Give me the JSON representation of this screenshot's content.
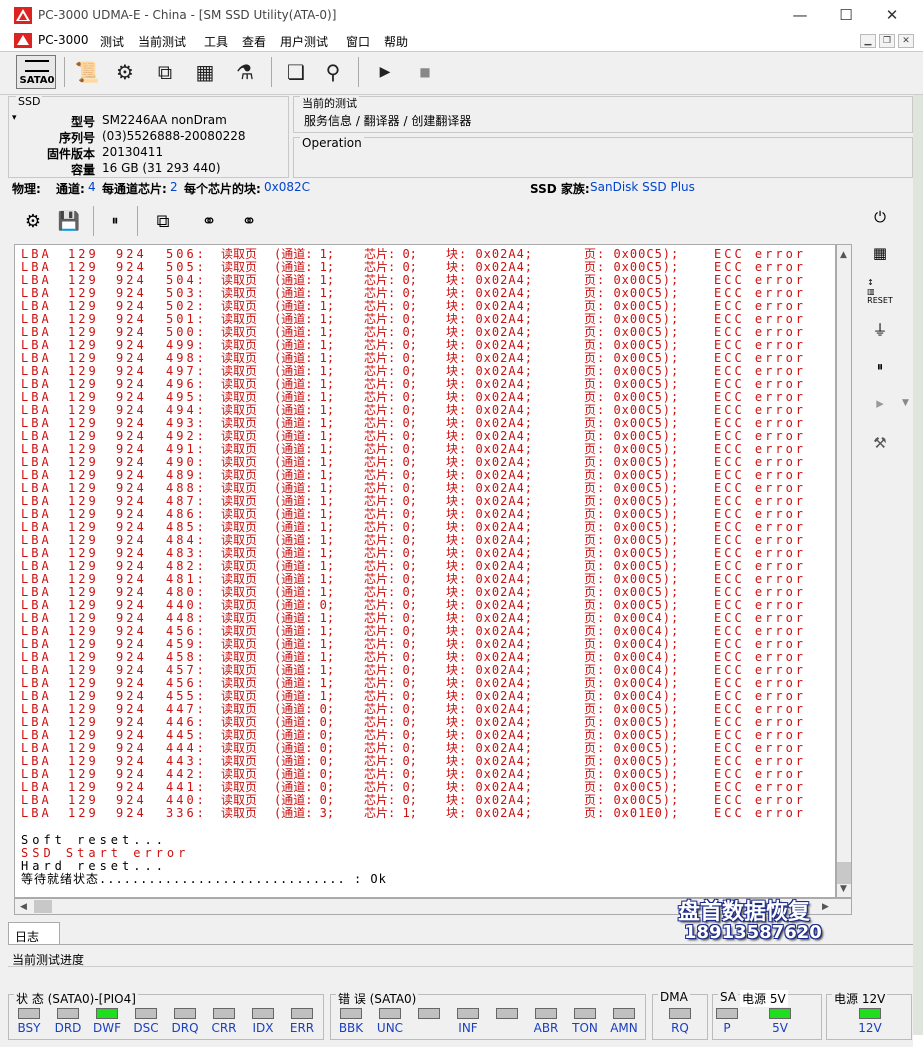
{
  "window": {
    "title": "PC-3000 UDMA-E - China - [SM SSD Utility(ATA-0)]",
    "min": "—",
    "max": "☐",
    "close": "✕"
  },
  "menu": [
    "PC-3000",
    "测试",
    "当前测试",
    "工具",
    "查看",
    "用户测试",
    "窗口",
    "帮助"
  ],
  "toolbar": {
    "sata_label": "SATA0"
  },
  "ssd": {
    "group_title": "SSD",
    "fields": [
      {
        "label": "型号",
        "value": "SM2246AA nonDram"
      },
      {
        "label": "序列号",
        "value": "(03)5526888-20080228"
      },
      {
        "label": "固件版本",
        "value": "20130411"
      },
      {
        "label": "容量",
        "value": "16 GB (31 293 440)"
      }
    ]
  },
  "current_test": {
    "title": "当前的测试",
    "path": "服务信息 / 翻译器 / 创建翻译器"
  },
  "operation": {
    "title": "Operation"
  },
  "physical": {
    "label": "物理:",
    "channels_label": "通道:",
    "channels": "4",
    "chips_label": "每通道芯片:",
    "chips": "2",
    "blocks_label": "每个芯片的块:",
    "blocks": "0x082C",
    "family_label": "SSD 家族:",
    "family": "SanDisk SSD Plus"
  },
  "log": {
    "rows": [
      {
        "lba": "LBA",
        "n1": "129",
        "n2": "924",
        "n3": "506:",
        "op": "读取页",
        "ch": "(通道: 1;",
        "chip": "芯片: 0;",
        "blk": "块: 0x02A4;",
        "pg": "页: 0x00C5);",
        "err": "ECC error"
      },
      {
        "lba": "LBA",
        "n1": "129",
        "n2": "924",
        "n3": "505:",
        "op": "读取页",
        "ch": "(通道: 1;",
        "chip": "芯片: 0;",
        "blk": "块: 0x02A4;",
        "pg": "页: 0x00C5);",
        "err": "ECC error"
      },
      {
        "lba": "LBA",
        "n1": "129",
        "n2": "924",
        "n3": "504:",
        "op": "读取页",
        "ch": "(通道: 1;",
        "chip": "芯片: 0;",
        "blk": "块: 0x02A4;",
        "pg": "页: 0x00C5);",
        "err": "ECC error"
      },
      {
        "lba": "LBA",
        "n1": "129",
        "n2": "924",
        "n3": "503:",
        "op": "读取页",
        "ch": "(通道: 1;",
        "chip": "芯片: 0;",
        "blk": "块: 0x02A4;",
        "pg": "页: 0x00C5);",
        "err": "ECC error"
      },
      {
        "lba": "LBA",
        "n1": "129",
        "n2": "924",
        "n3": "502:",
        "op": "读取页",
        "ch": "(通道: 1;",
        "chip": "芯片: 0;",
        "blk": "块: 0x02A4;",
        "pg": "页: 0x00C5);",
        "err": "ECC error"
      },
      {
        "lba": "LBA",
        "n1": "129",
        "n2": "924",
        "n3": "501:",
        "op": "读取页",
        "ch": "(通道: 1;",
        "chip": "芯片: 0;",
        "blk": "块: 0x02A4;",
        "pg": "页: 0x00C5);",
        "err": "ECC error"
      },
      {
        "lba": "LBA",
        "n1": "129",
        "n2": "924",
        "n3": "500:",
        "op": "读取页",
        "ch": "(通道: 1;",
        "chip": "芯片: 0;",
        "blk": "块: 0x02A4;",
        "pg": "页: 0x00C5);",
        "err": "ECC error"
      },
      {
        "lba": "LBA",
        "n1": "129",
        "n2": "924",
        "n3": "499:",
        "op": "读取页",
        "ch": "(通道: 1;",
        "chip": "芯片: 0;",
        "blk": "块: 0x02A4;",
        "pg": "页: 0x00C5);",
        "err": "ECC error"
      },
      {
        "lba": "LBA",
        "n1": "129",
        "n2": "924",
        "n3": "498:",
        "op": "读取页",
        "ch": "(通道: 1;",
        "chip": "芯片: 0;",
        "blk": "块: 0x02A4;",
        "pg": "页: 0x00C5);",
        "err": "ECC error"
      },
      {
        "lba": "LBA",
        "n1": "129",
        "n2": "924",
        "n3": "497:",
        "op": "读取页",
        "ch": "(通道: 1;",
        "chip": "芯片: 0;",
        "blk": "块: 0x02A4;",
        "pg": "页: 0x00C5);",
        "err": "ECC error"
      },
      {
        "lba": "LBA",
        "n1": "129",
        "n2": "924",
        "n3": "496:",
        "op": "读取页",
        "ch": "(通道: 1;",
        "chip": "芯片: 0;",
        "blk": "块: 0x02A4;",
        "pg": "页: 0x00C5);",
        "err": "ECC error"
      },
      {
        "lba": "LBA",
        "n1": "129",
        "n2": "924",
        "n3": "495:",
        "op": "读取页",
        "ch": "(通道: 1;",
        "chip": "芯片: 0;",
        "blk": "块: 0x02A4;",
        "pg": "页: 0x00C5);",
        "err": "ECC error"
      },
      {
        "lba": "LBA",
        "n1": "129",
        "n2": "924",
        "n3": "494:",
        "op": "读取页",
        "ch": "(通道: 1;",
        "chip": "芯片: 0;",
        "blk": "块: 0x02A4;",
        "pg": "页: 0x00C5);",
        "err": "ECC error"
      },
      {
        "lba": "LBA",
        "n1": "129",
        "n2": "924",
        "n3": "493:",
        "op": "读取页",
        "ch": "(通道: 1;",
        "chip": "芯片: 0;",
        "blk": "块: 0x02A4;",
        "pg": "页: 0x00C5);",
        "err": "ECC error"
      },
      {
        "lba": "LBA",
        "n1": "129",
        "n2": "924",
        "n3": "492:",
        "op": "读取页",
        "ch": "(通道: 1;",
        "chip": "芯片: 0;",
        "blk": "块: 0x02A4;",
        "pg": "页: 0x00C5);",
        "err": "ECC error"
      },
      {
        "lba": "LBA",
        "n1": "129",
        "n2": "924",
        "n3": "491:",
        "op": "读取页",
        "ch": "(通道: 1;",
        "chip": "芯片: 0;",
        "blk": "块: 0x02A4;",
        "pg": "页: 0x00C5);",
        "err": "ECC error"
      },
      {
        "lba": "LBA",
        "n1": "129",
        "n2": "924",
        "n3": "490:",
        "op": "读取页",
        "ch": "(通道: 1;",
        "chip": "芯片: 0;",
        "blk": "块: 0x02A4;",
        "pg": "页: 0x00C5);",
        "err": "ECC error"
      },
      {
        "lba": "LBA",
        "n1": "129",
        "n2": "924",
        "n3": "489:",
        "op": "读取页",
        "ch": "(通道: 1;",
        "chip": "芯片: 0;",
        "blk": "块: 0x02A4;",
        "pg": "页: 0x00C5);",
        "err": "ECC error"
      },
      {
        "lba": "LBA",
        "n1": "129",
        "n2": "924",
        "n3": "488:",
        "op": "读取页",
        "ch": "(通道: 1;",
        "chip": "芯片: 0;",
        "blk": "块: 0x02A4;",
        "pg": "页: 0x00C5);",
        "err": "ECC error"
      },
      {
        "lba": "LBA",
        "n1": "129",
        "n2": "924",
        "n3": "487:",
        "op": "读取页",
        "ch": "(通道: 1;",
        "chip": "芯片: 0;",
        "blk": "块: 0x02A4;",
        "pg": "页: 0x00C5);",
        "err": "ECC error"
      },
      {
        "lba": "LBA",
        "n1": "129",
        "n2": "924",
        "n3": "486:",
        "op": "读取页",
        "ch": "(通道: 1;",
        "chip": "芯片: 0;",
        "blk": "块: 0x02A4;",
        "pg": "页: 0x00C5);",
        "err": "ECC error"
      },
      {
        "lba": "LBA",
        "n1": "129",
        "n2": "924",
        "n3": "485:",
        "op": "读取页",
        "ch": "(通道: 1;",
        "chip": "芯片: 0;",
        "blk": "块: 0x02A4;",
        "pg": "页: 0x00C5);",
        "err": "ECC error"
      },
      {
        "lba": "LBA",
        "n1": "129",
        "n2": "924",
        "n3": "484:",
        "op": "读取页",
        "ch": "(通道: 1;",
        "chip": "芯片: 0;",
        "blk": "块: 0x02A4;",
        "pg": "页: 0x00C5);",
        "err": "ECC error"
      },
      {
        "lba": "LBA",
        "n1": "129",
        "n2": "924",
        "n3": "483:",
        "op": "读取页",
        "ch": "(通道: 1;",
        "chip": "芯片: 0;",
        "blk": "块: 0x02A4;",
        "pg": "页: 0x00C5);",
        "err": "ECC error"
      },
      {
        "lba": "LBA",
        "n1": "129",
        "n2": "924",
        "n3": "482:",
        "op": "读取页",
        "ch": "(通道: 1;",
        "chip": "芯片: 0;",
        "blk": "块: 0x02A4;",
        "pg": "页: 0x00C5);",
        "err": "ECC error"
      },
      {
        "lba": "LBA",
        "n1": "129",
        "n2": "924",
        "n3": "481:",
        "op": "读取页",
        "ch": "(通道: 1;",
        "chip": "芯片: 0;",
        "blk": "块: 0x02A4;",
        "pg": "页: 0x00C5);",
        "err": "ECC error"
      },
      {
        "lba": "LBA",
        "n1": "129",
        "n2": "924",
        "n3": "480:",
        "op": "读取页",
        "ch": "(通道: 1;",
        "chip": "芯片: 0;",
        "blk": "块: 0x02A4;",
        "pg": "页: 0x00C5);",
        "err": "ECC error"
      },
      {
        "lba": "LBA",
        "n1": "129",
        "n2": "924",
        "n3": "440:",
        "op": "读取页",
        "ch": "(通道: 0;",
        "chip": "芯片: 0;",
        "blk": "块: 0x02A4;",
        "pg": "页: 0x00C5);",
        "err": "ECC error"
      },
      {
        "lba": "LBA",
        "n1": "129",
        "n2": "924",
        "n3": "448:",
        "op": "读取页",
        "ch": "(通道: 1;",
        "chip": "芯片: 0;",
        "blk": "块: 0x02A4;",
        "pg": "页: 0x00C4);",
        "err": "ECC error"
      },
      {
        "lba": "LBA",
        "n1": "129",
        "n2": "924",
        "n3": "456:",
        "op": "读取页",
        "ch": "(通道: 1;",
        "chip": "芯片: 0;",
        "blk": "块: 0x02A4;",
        "pg": "页: 0x00C4);",
        "err": "ECC error"
      },
      {
        "lba": "LBA",
        "n1": "129",
        "n2": "924",
        "n3": "459:",
        "op": "读取页",
        "ch": "(通道: 1;",
        "chip": "芯片: 0;",
        "blk": "块: 0x02A4;",
        "pg": "页: 0x00C4);",
        "err": "ECC error"
      },
      {
        "lba": "LBA",
        "n1": "129",
        "n2": "924",
        "n3": "458:",
        "op": "读取页",
        "ch": "(通道: 1;",
        "chip": "芯片: 0;",
        "blk": "块: 0x02A4;",
        "pg": "页: 0x00C4);",
        "err": "ECC error"
      },
      {
        "lba": "LBA",
        "n1": "129",
        "n2": "924",
        "n3": "457:",
        "op": "读取页",
        "ch": "(通道: 1;",
        "chip": "芯片: 0;",
        "blk": "块: 0x02A4;",
        "pg": "页: 0x00C4);",
        "err": "ECC error"
      },
      {
        "lba": "LBA",
        "n1": "129",
        "n2": "924",
        "n3": "456:",
        "op": "读取页",
        "ch": "(通道: 1;",
        "chip": "芯片: 0;",
        "blk": "块: 0x02A4;",
        "pg": "页: 0x00C4);",
        "err": "ECC error"
      },
      {
        "lba": "LBA",
        "n1": "129",
        "n2": "924",
        "n3": "455:",
        "op": "读取页",
        "ch": "(通道: 1;",
        "chip": "芯片: 0;",
        "blk": "块: 0x02A4;",
        "pg": "页: 0x00C4);",
        "err": "ECC error"
      },
      {
        "lba": "LBA",
        "n1": "129",
        "n2": "924",
        "n3": "447:",
        "op": "读取页",
        "ch": "(通道: 0;",
        "chip": "芯片: 0;",
        "blk": "块: 0x02A4;",
        "pg": "页: 0x00C5);",
        "err": "ECC error"
      },
      {
        "lba": "LBA",
        "n1": "129",
        "n2": "924",
        "n3": "446:",
        "op": "读取页",
        "ch": "(通道: 0;",
        "chip": "芯片: 0;",
        "blk": "块: 0x02A4;",
        "pg": "页: 0x00C5);",
        "err": "ECC error"
      },
      {
        "lba": "LBA",
        "n1": "129",
        "n2": "924",
        "n3": "445:",
        "op": "读取页",
        "ch": "(通道: 0;",
        "chip": "芯片: 0;",
        "blk": "块: 0x02A4;",
        "pg": "页: 0x00C5);",
        "err": "ECC error"
      },
      {
        "lba": "LBA",
        "n1": "129",
        "n2": "924",
        "n3": "444:",
        "op": "读取页",
        "ch": "(通道: 0;",
        "chip": "芯片: 0;",
        "blk": "块: 0x02A4;",
        "pg": "页: 0x00C5);",
        "err": "ECC error"
      },
      {
        "lba": "LBA",
        "n1": "129",
        "n2": "924",
        "n3": "443:",
        "op": "读取页",
        "ch": "(通道: 0;",
        "chip": "芯片: 0;",
        "blk": "块: 0x02A4;",
        "pg": "页: 0x00C5);",
        "err": "ECC error"
      },
      {
        "lba": "LBA",
        "n1": "129",
        "n2": "924",
        "n3": "442:",
        "op": "读取页",
        "ch": "(通道: 0;",
        "chip": "芯片: 0;",
        "blk": "块: 0x02A4;",
        "pg": "页: 0x00C5);",
        "err": "ECC error"
      },
      {
        "lba": "LBA",
        "n1": "129",
        "n2": "924",
        "n3": "441:",
        "op": "读取页",
        "ch": "(通道: 0;",
        "chip": "芯片: 0;",
        "blk": "块: 0x02A4;",
        "pg": "页: 0x00C5);",
        "err": "ECC error"
      },
      {
        "lba": "LBA",
        "n1": "129",
        "n2": "924",
        "n3": "440:",
        "op": "读取页",
        "ch": "(通道: 0;",
        "chip": "芯片: 0;",
        "blk": "块: 0x02A4;",
        "pg": "页: 0x00C5);",
        "err": "ECC error"
      },
      {
        "lba": "LBA",
        "n1": "129",
        "n2": "924",
        "n3": "336:",
        "op": "读取页",
        "ch": "(通道: 3;",
        "chip": "芯片: 1;",
        "blk": "块: 0x02A4;",
        "pg": "页: 0x01E0);",
        "err": "ECC error"
      }
    ],
    "status_lines": [
      {
        "text": "Soft reset...",
        "color": "#000000"
      },
      {
        "text": "SSD Start error",
        "color": "#cc1111"
      },
      {
        "text": "Hard reset...",
        "color": "#000000"
      },
      {
        "text": "等待就绪状态.............................. : Ok",
        "color": "#000000"
      }
    ]
  },
  "tab": {
    "label": "日志"
  },
  "progress": {
    "label": "当前测试进度"
  },
  "statusbar": {
    "status_title": "状 态 (SATA0)-[PIO4]",
    "status_leds": [
      {
        "name": "BSY",
        "on": false
      },
      {
        "name": "DRD",
        "on": false
      },
      {
        "name": "DWF",
        "on": true
      },
      {
        "name": "DSC",
        "on": false
      },
      {
        "name": "DRQ",
        "on": false
      },
      {
        "name": "CRR",
        "on": false
      },
      {
        "name": "IDX",
        "on": false
      },
      {
        "name": "ERR",
        "on": false
      }
    ],
    "error_title": "错 误 (SATA0)",
    "error_leds": [
      {
        "name": "BBK",
        "on": false
      },
      {
        "name": "UNC",
        "on": false
      },
      {
        "name": "",
        "on": false
      },
      {
        "name": "INF",
        "on": false
      },
      {
        "name": "",
        "on": false
      },
      {
        "name": "ABR",
        "on": false
      },
      {
        "name": "TON",
        "on": false
      },
      {
        "name": "AMN",
        "on": false
      }
    ],
    "dma_title": "DMA",
    "dma_led": "RQ",
    "sa_title": "SA",
    "sa_led": "P",
    "power5_title": "电源 5V",
    "power5_led": "5V",
    "power12_title": "电源 12V",
    "power12_led": "12V"
  },
  "watermark": {
    "text": "盘首数据恢复",
    "phone": "18913587620"
  },
  "colors": {
    "error_text": "#cc1111",
    "value_blue": "#0044cc",
    "led_on": "#20dd20",
    "led_off": "#c0c0c0"
  }
}
